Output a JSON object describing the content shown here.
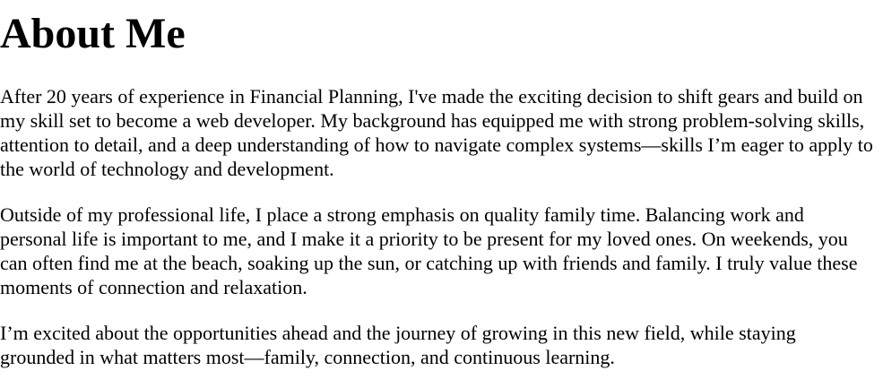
{
  "page": {
    "title": "About Me",
    "paragraphs": [
      "After 20 years of experience in Financial Planning, I've made the exciting decision to shift gears and build on my skill set to become a web developer. My background has equipped me with strong problem-solving skills, attention to detail, and a deep understanding of how to navigate complex systems—skills I’m eager to apply to the world of technology and development.",
      "Outside of my professional life, I place a strong emphasis on quality family time. Balancing work and personal life is important to me, and I make it a priority to be present for my loved ones. On weekends, you can often find me at the beach, soaking up the sun, or catching up with friends and family. I truly value these moments of connection and relaxation.",
      "I’m excited about the opportunities ahead and the journey of growing in this new field, while staying grounded in what matters most—family, connection, and continuous learning."
    ]
  }
}
